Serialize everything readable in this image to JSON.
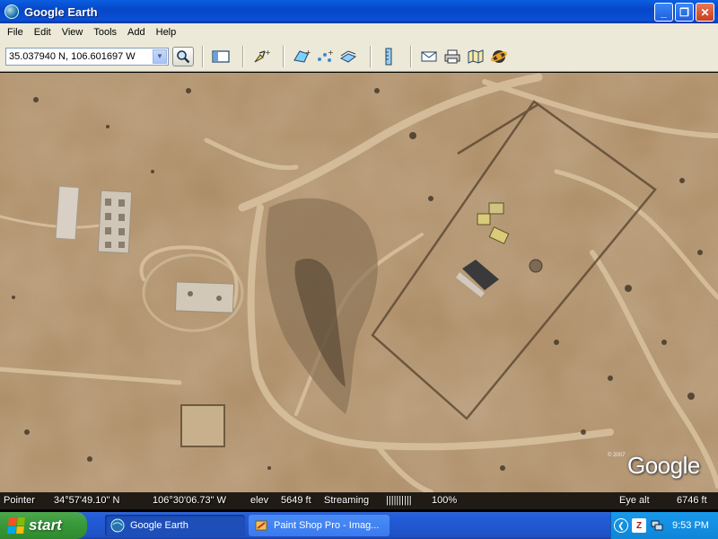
{
  "window": {
    "title": "Google Earth",
    "controls": [
      "_",
      "❐",
      "✕"
    ]
  },
  "menu": [
    "File",
    "Edit",
    "View",
    "Tools",
    "Add",
    "Help"
  ],
  "toolbar": {
    "search_value": "35.037940 N, 106.601697 W",
    "tools": [
      "sidebar-icon",
      "placemark-icon",
      "polygon-icon",
      "path-icon",
      "image-overlay-icon",
      "ruler-icon",
      "email-icon",
      "print-icon",
      "maps-icon",
      "sky-icon"
    ]
  },
  "map": {
    "logo": "Google",
    "copyright": "© 2007"
  },
  "status": {
    "pointer_label": "Pointer",
    "lat": "34°57'49.10\" N",
    "lon": "106°30'06.73\" W",
    "elev_label": "elev",
    "elev_value": "5649 ft",
    "streaming_label": "Streaming",
    "streaming_bar": "||||||||||",
    "streaming_pct": "100%",
    "eye_alt_label": "Eye alt",
    "eye_alt_value": "6746 ft"
  },
  "taskbar": {
    "start_label": "start",
    "tasks": [
      {
        "label": "Google Earth",
        "active": true
      },
      {
        "label": "Paint Shop Pro - Imag...",
        "active": false
      }
    ],
    "tray_letter": "Z",
    "clock": "9:53 PM"
  },
  "colors": {
    "terrain": "#b48d62",
    "titlebar": "#0a5fe0",
    "taskbar": "#245edb",
    "start": "#3a9a3a"
  }
}
